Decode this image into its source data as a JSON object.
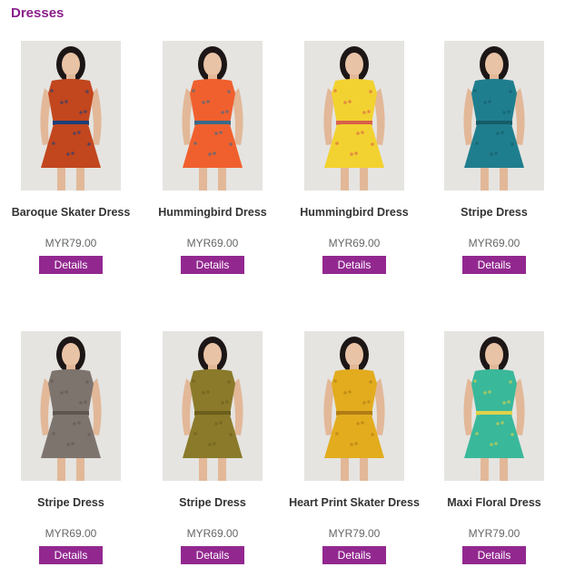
{
  "page": {
    "title": "Dresses"
  },
  "products": [
    {
      "name": "Baroque Skater Dress",
      "price": "MYR79.00",
      "button": "Details",
      "dress_color": "#c2461e",
      "accent_color": "#1d3f7a"
    },
    {
      "name": "Hummingbird Dress",
      "price": "MYR69.00",
      "button": "Details",
      "dress_color": "#f0602e",
      "accent_color": "#3a6a8a"
    },
    {
      "name": "Hummingbird Dress",
      "price": "MYR69.00",
      "button": "Details",
      "dress_color": "#f2d230",
      "accent_color": "#d8604a"
    },
    {
      "name": "Stripe Dress",
      "price": "MYR69.00",
      "button": "Details",
      "dress_color": "#1f7e8e",
      "accent_color": "#155c68"
    },
    {
      "name": "Stripe Dress",
      "price": "MYR69.00",
      "button": "Details",
      "dress_color": "#7e746e",
      "accent_color": "#5e5650"
    },
    {
      "name": "Stripe Dress",
      "price": "MYR69.00",
      "button": "Details",
      "dress_color": "#8a7a2a",
      "accent_color": "#6c5e1c"
    },
    {
      "name": "Heart Print Skater Dress",
      "price": "MYR79.00",
      "button": "Details",
      "dress_color": "#e2ac1e",
      "accent_color": "#b07c14"
    },
    {
      "name": "Maxi Floral Dress",
      "price": "MYR79.00",
      "button": "Details",
      "dress_color": "#3ab89a",
      "accent_color": "#e0d24a"
    }
  ],
  "colors": {
    "title": "#8a1e8a",
    "button_bg": "#92288f",
    "button_text": "#ffffff",
    "name_text": "#333333",
    "price_text": "#666666",
    "photo_bg": "#ececea"
  }
}
